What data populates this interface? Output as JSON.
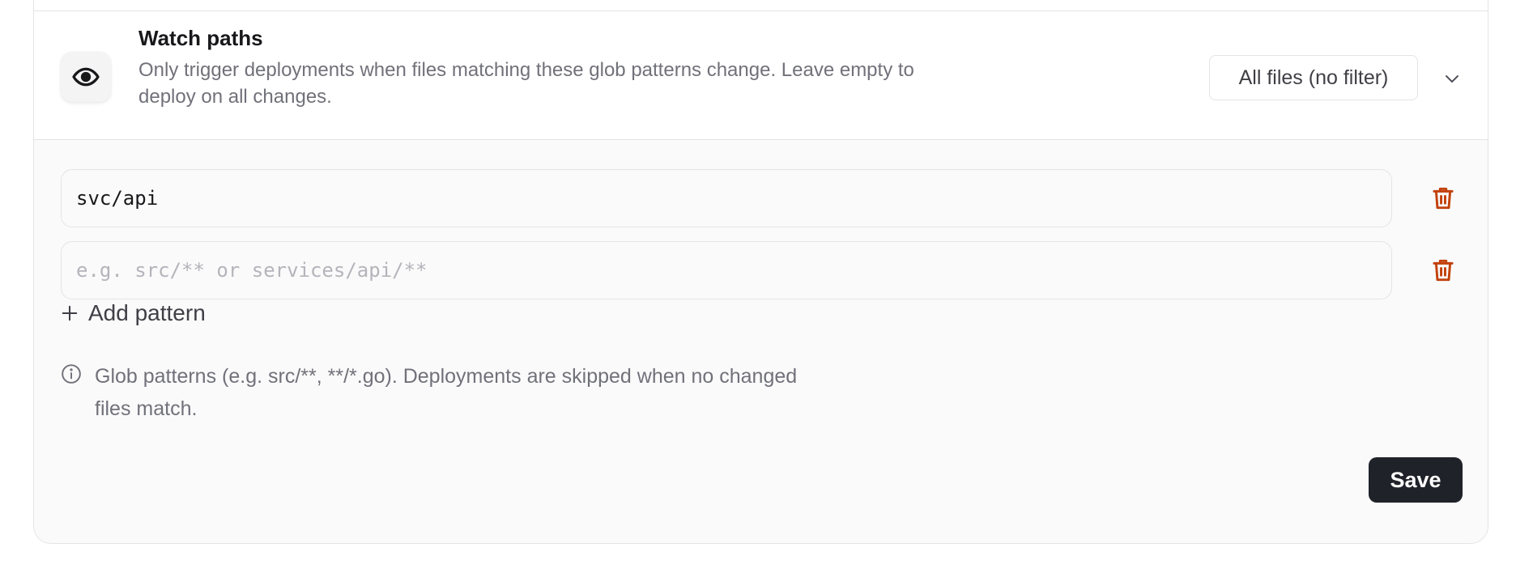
{
  "section": {
    "title": "Watch paths",
    "description": "Only trigger deployments when files matching these glob patterns change. Leave empty to deploy on all changes.",
    "icon": "eye-icon",
    "filter_select": {
      "value": "All files (no filter)"
    }
  },
  "patterns": [
    {
      "value": "svc/api",
      "placeholder": ""
    },
    {
      "value": "",
      "placeholder": "e.g. src/** or services/api/**"
    }
  ],
  "add_pattern_label": "Add pattern",
  "hint": "Glob patterns (e.g. src/**, **/*.go). Deployments are skipped when no changed files match.",
  "save_label": "Save",
  "colors": {
    "danger": "#c2410c",
    "button_bg": "#1f2228",
    "muted_text": "#71717a",
    "border": "#e4e4e7"
  }
}
